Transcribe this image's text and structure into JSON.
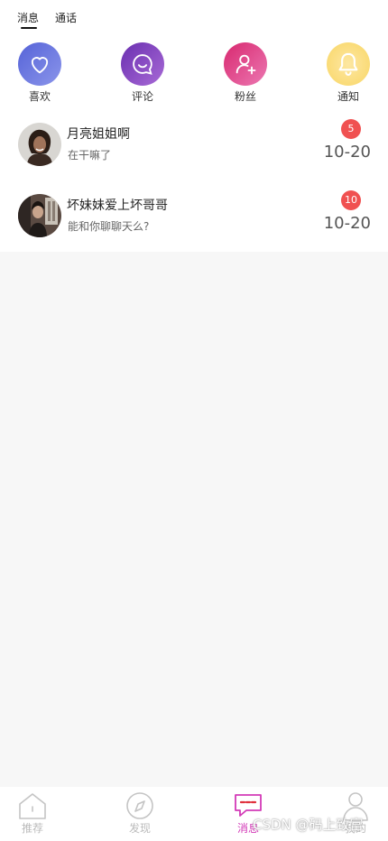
{
  "tabs": [
    {
      "label": "消息",
      "active": true
    },
    {
      "label": "通话",
      "active": false
    }
  ],
  "categories": [
    {
      "label": "喜欢",
      "icon": "heart-icon"
    },
    {
      "label": "评论",
      "icon": "comment-icon"
    },
    {
      "label": "粉丝",
      "icon": "add-user-icon"
    },
    {
      "label": "通知",
      "icon": "bell-icon"
    }
  ],
  "messages": [
    {
      "name": "月亮姐姐啊",
      "preview": "在干嘛了",
      "badge": "5",
      "date": "10-20"
    },
    {
      "name": "坏妹妹爱上坏哥哥",
      "preview": "能和你聊聊天么?",
      "badge": "10",
      "date": "10-20"
    }
  ],
  "bottom_nav": [
    {
      "label": "推荐",
      "icon": "home-icon",
      "active": false
    },
    {
      "label": "发现",
      "icon": "compass-icon",
      "active": false
    },
    {
      "label": "消息",
      "icon": "message-icon",
      "active": true
    },
    {
      "label": "我的",
      "icon": "user-icon",
      "active": false
    }
  ],
  "colors": {
    "accent": "#d33ab7",
    "badge": "#f05151"
  },
  "watermark": "CSDN @码上致富"
}
